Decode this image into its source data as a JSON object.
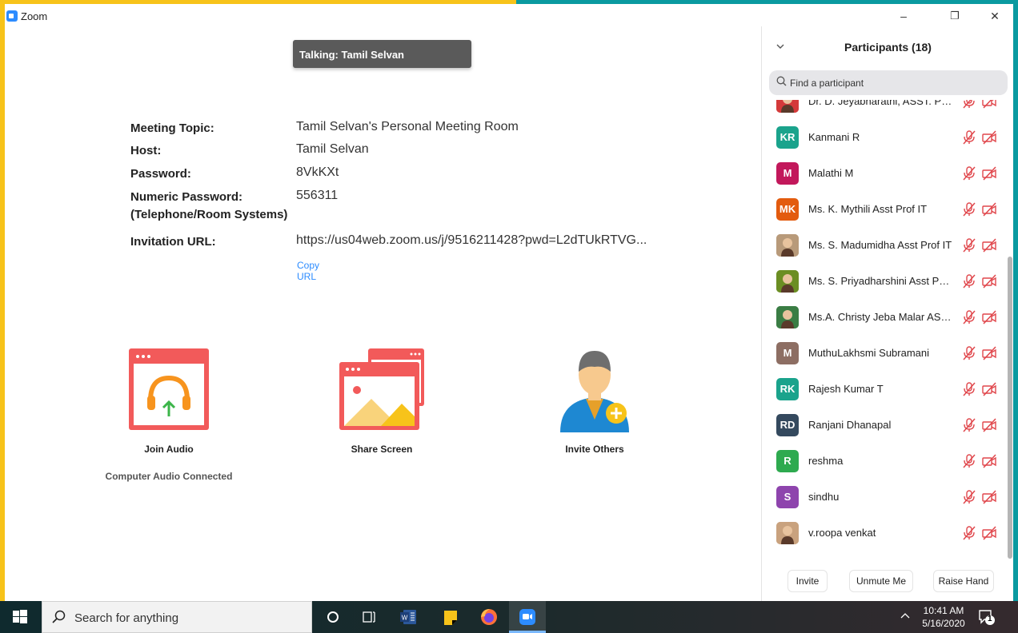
{
  "window": {
    "app_title": "Zoom",
    "minimize": "–",
    "restore": "❐",
    "close": "✕"
  },
  "talking": "Talking: Tamil Selvan",
  "meeting_info": {
    "topic_label": "Meeting Topic:",
    "topic_value": "Tamil Selvan's Personal Meeting Room",
    "host_label": "Host:",
    "host_value": "Tamil Selvan",
    "password_label": "Password:",
    "password_value": "8VkKXt",
    "numeric_password_label": "Numeric Password:",
    "numeric_password_sub": "(Telephone/Room Systems)",
    "numeric_password_value": "556311",
    "invitation_label": "Invitation URL:",
    "invitation_value": "https://us04web.zoom.us/j/9516211428?pwd=L2dTUkRTVG...",
    "copy_url": "Copy URL"
  },
  "actions": {
    "join_audio": "Join Audio",
    "join_audio_status": "Computer Audio Connected",
    "share_screen": "Share Screen",
    "invite_others": "Invite Others"
  },
  "panel": {
    "title": "Participants (18)",
    "collapse_icon": "chevron-down",
    "search_placeholder": "Find a participant",
    "participants": [
      {
        "name": "Dr. D. Jeyabharathi, ASST. PROF",
        "initials": "",
        "color": "#d43a3a",
        "photo": true
      },
      {
        "name": "Kanmani R",
        "initials": "KR",
        "color": "#1aa38c",
        "photo": false
      },
      {
        "name": "Malathi M",
        "initials": "M",
        "color": "#c2185b",
        "photo": false
      },
      {
        "name": "Ms. K. Mythili Asst Prof IT",
        "initials": "MK",
        "color": "#e35b0e",
        "photo": false
      },
      {
        "name": "Ms. S. Madumidha Asst Prof IT",
        "initials": "",
        "color": "#b89a7a",
        "photo": true
      },
      {
        "name": "Ms. S. Priyadharshini Asst Prof IT",
        "initials": "",
        "color": "#6b8e23",
        "photo": true
      },
      {
        "name": "Ms.A. Christy Jeba Malar ASST. ...",
        "initials": "",
        "color": "#3a7d44",
        "photo": true
      },
      {
        "name": "MuthuLakhsmi Subramani",
        "initials": "M",
        "color": "#8d6e63",
        "photo": false
      },
      {
        "name": "Rajesh Kumar T",
        "initials": "RK",
        "color": "#1aa38c",
        "photo": false
      },
      {
        "name": "Ranjani Dhanapal",
        "initials": "RD",
        "color": "#34495e",
        "photo": false
      },
      {
        "name": "reshma",
        "initials": "R",
        "color": "#2eaa4f",
        "photo": false
      },
      {
        "name": "sindhu",
        "initials": "S",
        "color": "#8e44ad",
        "photo": false
      },
      {
        "name": "v.roopa venkat",
        "initials": "",
        "color": "#c9a27e",
        "photo": true
      }
    ],
    "invite": "Invite",
    "unmute": "Unmute Me",
    "raise_hand": "Raise Hand"
  },
  "taskbar": {
    "search_text": "Search for anything",
    "time": "10:41 AM",
    "date": "5/16/2020",
    "notification_count": "1"
  },
  "colors": {
    "share_border_left": "#F7C31A",
    "share_border_right": "#0A9AA0",
    "accent": "#2D8CFF",
    "tile_red": "#F25A5A",
    "muted_red": "#E0474C"
  }
}
